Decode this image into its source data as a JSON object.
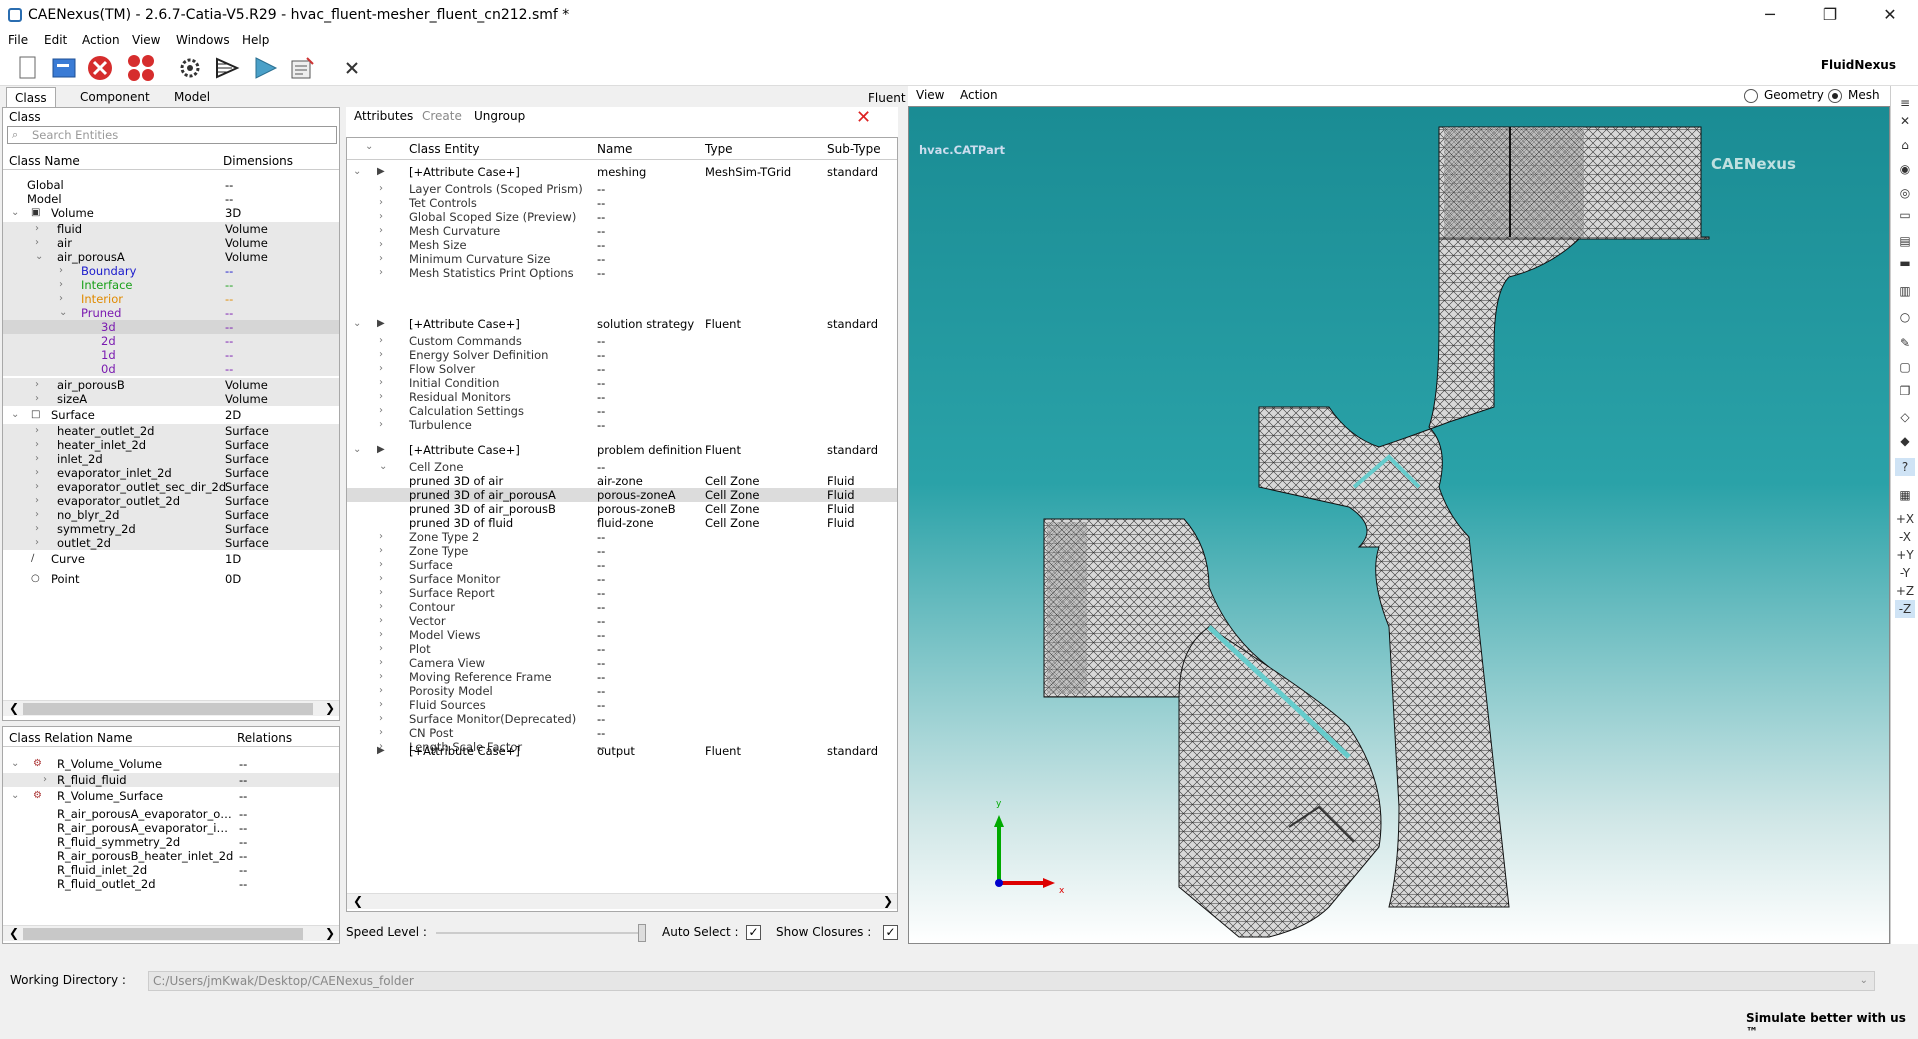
{
  "window": {
    "title": "CAENexus(TM) - 2.6.7-Catia-V5.R29 - hvac_fluent-mesher_fluent_cn212.smf  *"
  },
  "menu": [
    "File",
    "Edit",
    "Action",
    "View",
    "Windows",
    "Help"
  ],
  "brand": "FluidNexus",
  "left_tabs": [
    "Class",
    "Component",
    "Model"
  ],
  "class_panel": {
    "label": "Class",
    "search_placeholder": "Search Entities",
    "col_name": "Class Name",
    "col_dim": "Dimensions",
    "rows": [
      {
        "name": "Global",
        "dim": "--"
      },
      {
        "name": "Model",
        "dim": "--"
      },
      {
        "name": "Volume",
        "dim": "3D"
      },
      {
        "name": "fluid",
        "dim": "Volume"
      },
      {
        "name": "air",
        "dim": "Volume"
      },
      {
        "name": "air_porousA",
        "dim": "Volume"
      },
      {
        "name": "Boundary",
        "dim": "--"
      },
      {
        "name": "Interface",
        "dim": "--"
      },
      {
        "name": "Interior",
        "dim": "--"
      },
      {
        "name": "Pruned",
        "dim": "--"
      },
      {
        "name": "3d",
        "dim": "--"
      },
      {
        "name": "2d",
        "dim": "--"
      },
      {
        "name": "1d",
        "dim": "--"
      },
      {
        "name": "0d",
        "dim": "--"
      },
      {
        "name": "air_porousB",
        "dim": "Volume"
      },
      {
        "name": "sizeA",
        "dim": "Volume"
      },
      {
        "name": "Surface",
        "dim": "2D"
      },
      {
        "name": "heater_outlet_2d",
        "dim": "Surface"
      },
      {
        "name": "heater_inlet_2d",
        "dim": "Surface"
      },
      {
        "name": "inlet_2d",
        "dim": "Surface"
      },
      {
        "name": "evaporator_inlet_2d",
        "dim": "Surface"
      },
      {
        "name": "evaporator_outlet_sec_dir_2d",
        "dim": "Surface"
      },
      {
        "name": "evaporator_outlet_2d",
        "dim": "Surface"
      },
      {
        "name": "no_blyr_2d",
        "dim": "Surface"
      },
      {
        "name": "symmetry_2d",
        "dim": "Surface"
      },
      {
        "name": "outlet_2d",
        "dim": "Surface"
      },
      {
        "name": "Curve",
        "dim": "1D"
      },
      {
        "name": "Point",
        "dim": "0D"
      }
    ]
  },
  "relation_panel": {
    "col_name": "Class Relation Name",
    "col_rel": "Relations",
    "rows": [
      {
        "name": "R_Volume_Volume",
        "rel": "--"
      },
      {
        "name": "R_fluid_fluid",
        "rel": "--"
      },
      {
        "name": "R_Volume_Surface",
        "rel": "--"
      },
      {
        "name": "R_air_porousA_evaporator_o…",
        "rel": "--"
      },
      {
        "name": "R_air_porousA_evaporator_i…",
        "rel": "--"
      },
      {
        "name": "R_fluid_symmetry_2d",
        "rel": "--"
      },
      {
        "name": "R_air_porousB_heater_inlet_2d",
        "rel": "--"
      },
      {
        "name": "R_fluid_inlet_2d",
        "rel": "--"
      },
      {
        "name": "R_fluid_outlet_2d",
        "rel": "--"
      }
    ]
  },
  "attr_panel": {
    "fluent_label": "Fluent",
    "tabs": [
      "Attributes",
      "Create",
      "Ungroup"
    ],
    "cols": [
      "Class Entity",
      "Name",
      "Type",
      "Sub-Type"
    ],
    "rows": [
      {
        "entity": "[+Attribute Case+]",
        "name": "meshing",
        "type": "MeshSim-TGrid",
        "sub": "standard"
      },
      {
        "entity": "Layer Controls (Scoped Prism)",
        "name": "--",
        "type": "",
        "sub": ""
      },
      {
        "entity": "Tet Controls",
        "name": "--",
        "type": "",
        "sub": ""
      },
      {
        "entity": "Global Scoped Size (Preview)",
        "name": "--",
        "type": "",
        "sub": ""
      },
      {
        "entity": "Mesh Curvature",
        "name": "--",
        "type": "",
        "sub": ""
      },
      {
        "entity": "Mesh Size",
        "name": "--",
        "type": "",
        "sub": ""
      },
      {
        "entity": "Minimum Curvature Size",
        "name": "--",
        "type": "",
        "sub": ""
      },
      {
        "entity": "Mesh Statistics Print Options",
        "name": "--",
        "type": "",
        "sub": ""
      },
      {
        "entity": "[+Attribute Case+]",
        "name": "solution strategy",
        "type": "Fluent",
        "sub": "standard"
      },
      {
        "entity": "Custom Commands",
        "name": "--",
        "type": "",
        "sub": ""
      },
      {
        "entity": "Energy Solver Definition",
        "name": "--",
        "type": "",
        "sub": ""
      },
      {
        "entity": "Flow Solver",
        "name": "--",
        "type": "",
        "sub": ""
      },
      {
        "entity": "Initial Condition",
        "name": "--",
        "type": "",
        "sub": ""
      },
      {
        "entity": "Residual Monitors",
        "name": "--",
        "type": "",
        "sub": ""
      },
      {
        "entity": "Calculation Settings",
        "name": "--",
        "type": "",
        "sub": ""
      },
      {
        "entity": "Turbulence",
        "name": "--",
        "type": "",
        "sub": ""
      },
      {
        "entity": "[+Attribute Case+]",
        "name": "problem definition",
        "type": "Fluent",
        "sub": "standard"
      },
      {
        "entity": "Cell Zone",
        "name": "--",
        "type": "",
        "sub": ""
      },
      {
        "entity": "pruned 3D of air",
        "name": "air-zone",
        "type": "Cell Zone",
        "sub": "Fluid"
      },
      {
        "entity": "pruned 3D of air_porousA",
        "name": "porous-zoneA",
        "type": "Cell Zone",
        "sub": "Fluid"
      },
      {
        "entity": "pruned 3D of air_porousB",
        "name": "porous-zoneB",
        "type": "Cell Zone",
        "sub": "Fluid"
      },
      {
        "entity": "pruned 3D of fluid",
        "name": "fluid-zone",
        "type": "Cell Zone",
        "sub": "Fluid"
      },
      {
        "entity": "Zone Type 2",
        "name": "--",
        "type": "",
        "sub": ""
      },
      {
        "entity": "Zone Type",
        "name": "--",
        "type": "",
        "sub": ""
      },
      {
        "entity": "Surface",
        "name": "--",
        "type": "",
        "sub": ""
      },
      {
        "entity": "Surface Monitor",
        "name": "--",
        "type": "",
        "sub": ""
      },
      {
        "entity": "Surface Report",
        "name": "--",
        "type": "",
        "sub": ""
      },
      {
        "entity": "Contour",
        "name": "--",
        "type": "",
        "sub": ""
      },
      {
        "entity": "Vector",
        "name": "--",
        "type": "",
        "sub": ""
      },
      {
        "entity": "Model Views",
        "name": "--",
        "type": "",
        "sub": ""
      },
      {
        "entity": "Plot",
        "name": "--",
        "type": "",
        "sub": ""
      },
      {
        "entity": "Camera View",
        "name": "--",
        "type": "",
        "sub": ""
      },
      {
        "entity": "Moving Reference Frame",
        "name": "--",
        "type": "",
        "sub": ""
      },
      {
        "entity": "Porosity Model",
        "name": "--",
        "type": "",
        "sub": ""
      },
      {
        "entity": "Fluid Sources",
        "name": "--",
        "type": "",
        "sub": ""
      },
      {
        "entity": "Surface Monitor(Deprecated)",
        "name": "--",
        "type": "",
        "sub": ""
      },
      {
        "entity": "CN Post",
        "name": "--",
        "type": "",
        "sub": ""
      },
      {
        "entity": "Length Scale Factor",
        "name": "--",
        "type": "",
        "sub": ""
      },
      {
        "entity": "[+Attribute Case+]",
        "name": "output",
        "type": "Fluent",
        "sub": "standard"
      }
    ],
    "speed_label": "Speed Level :",
    "auto_select_label": "Auto Select :",
    "show_closures_label": "Show Closures :"
  },
  "viewer": {
    "menu": [
      "View",
      "Action"
    ],
    "geometry_label": "Geometry",
    "mesh_label": "Mesh",
    "part_name": "hvac.CATPart",
    "watermark": "CAENexus",
    "axes": {
      "x": "x",
      "y": "y"
    },
    "right_tools": [
      "+X",
      "-X",
      "+Y",
      "-Y",
      "+Z",
      "-Z"
    ]
  },
  "status": {
    "wd_label": "Working Directory :",
    "wd_value": "C:/Users/jmKwak/Desktop/CAENexus_folder",
    "slogan": "Simulate better with us ™"
  }
}
